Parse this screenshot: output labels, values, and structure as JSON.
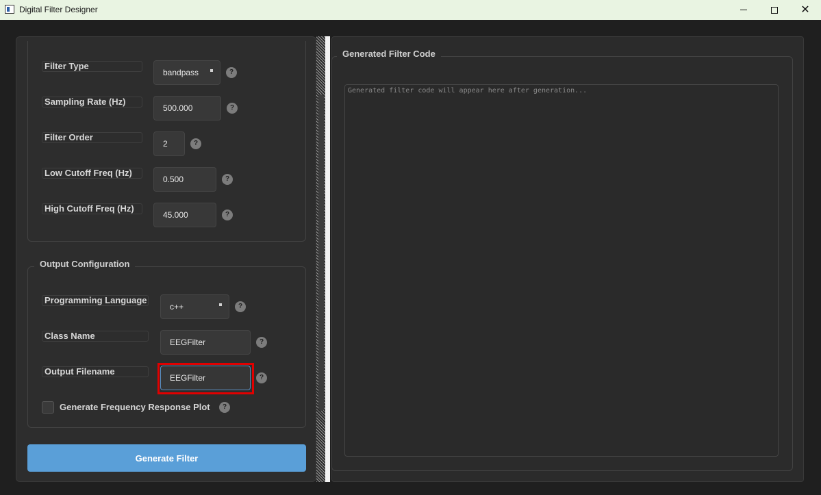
{
  "window": {
    "title": "Digital Filter Designer",
    "minimize_label": "",
    "maximize_label": "",
    "close_label": "✕"
  },
  "filter_params": {
    "filter_type": {
      "label": "Filter Type",
      "value": "bandpass"
    },
    "sampling_rate": {
      "label": "Sampling Rate (Hz)",
      "value": "500.000"
    },
    "filter_order": {
      "label": "Filter Order",
      "value": "2"
    },
    "low_cutoff": {
      "label": "Low Cutoff Freq (Hz)",
      "value": "0.500"
    },
    "high_cutoff": {
      "label": "High Cutoff Freq (Hz)",
      "value": "45.000"
    }
  },
  "output_config": {
    "title": "Output Configuration",
    "language": {
      "label": "Programming Language",
      "value": "c++"
    },
    "class_name": {
      "label": "Class Name",
      "value": "EEGFilter"
    },
    "filename": {
      "label": "Output Filename",
      "value": "EEGFilter"
    },
    "plot_checkbox": {
      "label": "Generate Frequency Response Plot",
      "checked": false
    }
  },
  "help_glyph": "?",
  "generate_button": "Generate Filter",
  "code_panel": {
    "title": "Generated Filter Code",
    "placeholder": "Generated filter code will appear here after generation..."
  },
  "colors": {
    "accent": "#5a9fd8",
    "highlight": "#e00000",
    "background": "#1f1f1f"
  }
}
